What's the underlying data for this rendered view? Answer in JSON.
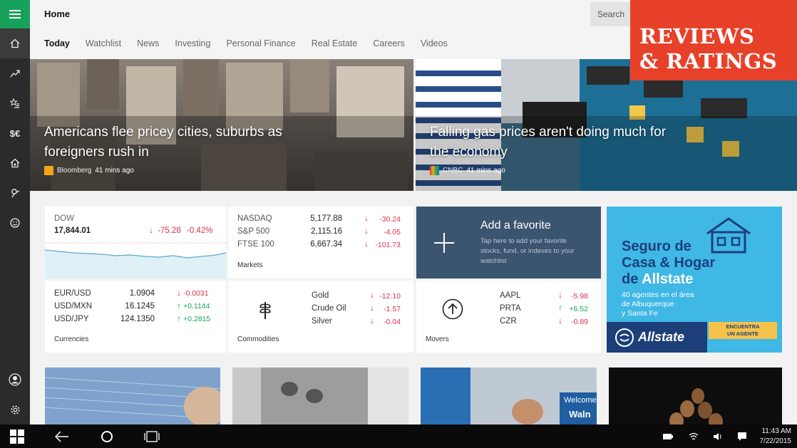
{
  "header": {
    "title": "Home",
    "search_placeholder": "Search"
  },
  "tabs": [
    "Today",
    "Watchlist",
    "News",
    "Investing",
    "Personal Finance",
    "Real Estate",
    "Careers",
    "Videos"
  ],
  "badge": {
    "line1": "REVIEWS",
    "line2": "& RATINGS"
  },
  "hero": [
    {
      "headline_1": "Americans flee pricey cities, suburbs as",
      "headline_2": "foreigners rush in",
      "source": "Bloomberg",
      "time": "41 mins ago"
    },
    {
      "headline_1": "Falling gas prices aren't doing much for",
      "headline_2": "the economy",
      "source": "CNBC",
      "time": "41 mins ago"
    }
  ],
  "dow": {
    "name": "DOW",
    "value": "17,844.01",
    "change": "-75.28",
    "pct": "-0.42%"
  },
  "markets": {
    "label": "Markets",
    "rows": [
      {
        "name": "NASDAQ",
        "value": "5,177.88",
        "change": "-30.24"
      },
      {
        "name": "S&P 500",
        "value": "2,115.16",
        "change": "-4.05"
      },
      {
        "name": "FTSE 100",
        "value": "6,667.34",
        "change": "-101.73"
      }
    ]
  },
  "favorite": {
    "title": "Add a favorite",
    "desc_1": "Tap here to add your favorite",
    "desc_2": "stocks, fund, or indexes to your",
    "desc_3": "watchlist"
  },
  "ad": {
    "line1": "Seguro de",
    "line2": "Casa & Hogar",
    "line3a": "de ",
    "line3b": "Allstate",
    "sub1": "40 agentes en el área",
    "sub2": "de Albuquerque",
    "sub3": "y Santa Fe",
    "brand": "Allstate",
    "cta1": "ENCUENTRA",
    "cta2": "UN AGENTE"
  },
  "currencies": {
    "label": "Currencies",
    "rows": [
      {
        "name": "EUR/USD",
        "value": "1.0904",
        "change": "-0.0031"
      },
      {
        "name": "USD/MXN",
        "value": "16.1245",
        "change": "+0.1144"
      },
      {
        "name": "USD/JPY",
        "value": "124.1350",
        "change": "+0.2815"
      }
    ]
  },
  "commodities": {
    "label": "Commodities",
    "rows": [
      {
        "name": "Gold",
        "change": "-12.10"
      },
      {
        "name": "Crude Oil",
        "change": "-1.57"
      },
      {
        "name": "Silver",
        "change": "-0.04"
      }
    ]
  },
  "movers": {
    "label": "Movers",
    "rows": [
      {
        "name": "AAPL",
        "change": "-5.98"
      },
      {
        "name": "PRTA",
        "change": "+6.52"
      },
      {
        "name": "CZR",
        "change": "-0.89"
      }
    ]
  },
  "tile4_text": "Welcome",
  "tile4_text2": "Waln",
  "taskbar": {
    "time": "11:43 AM",
    "date": "7/22/2015"
  },
  "colors": {
    "accent_green": "#18a15a",
    "negative": "#d6334b",
    "positive": "#17a55a",
    "favorite_bg": "#3b5470",
    "badge": "#e8412a",
    "ad_bg": "#3fb8e6"
  }
}
